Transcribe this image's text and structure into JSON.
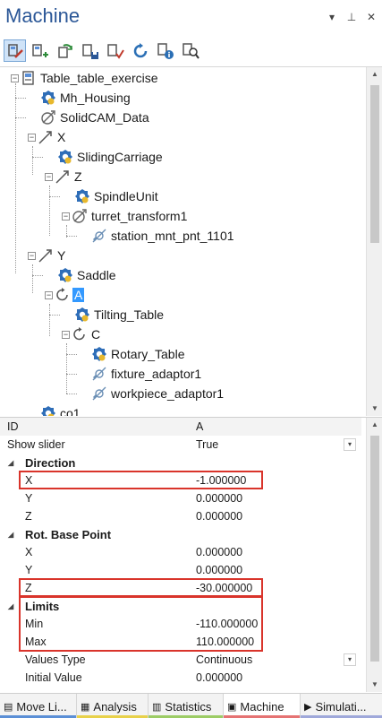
{
  "panel": {
    "title": "Machine",
    "controls": {
      "menu": "▾",
      "pin": "⊥",
      "close": "✕"
    }
  },
  "toolbar": {
    "buttons": [
      {
        "name": "edit-machine-icon"
      },
      {
        "name": "add-item-icon"
      },
      {
        "name": "refresh-icon"
      },
      {
        "name": "save-icon"
      },
      {
        "name": "check-icon"
      },
      {
        "name": "rotate-icon"
      },
      {
        "name": "info-icon"
      },
      {
        "name": "search-icon"
      }
    ]
  },
  "tree": {
    "nodes": [
      {
        "label": "Table_table_exercise",
        "icon": "machine"
      },
      {
        "label": "Mh_Housing",
        "icon": "part"
      },
      {
        "label": "SolidCAM_Data",
        "icon": "transform"
      },
      {
        "label": "X",
        "icon": "axis-linear"
      },
      {
        "label": "SlidingCarriage",
        "icon": "part"
      },
      {
        "label": "Z",
        "icon": "axis-linear"
      },
      {
        "label": "SpindleUnit",
        "icon": "part"
      },
      {
        "label": "turret_transform1",
        "icon": "transform"
      },
      {
        "label": "station_mnt_pnt_1101",
        "icon": "mount"
      },
      {
        "label": "Y",
        "icon": "axis-linear"
      },
      {
        "label": "Saddle",
        "icon": "part"
      },
      {
        "label": "A",
        "icon": "axis-rotary",
        "selected": true
      },
      {
        "label": "Tilting_Table",
        "icon": "part"
      },
      {
        "label": "C",
        "icon": "axis-rotary"
      },
      {
        "label": "Rotary_Table",
        "icon": "part"
      },
      {
        "label": "fixture_adaptor1",
        "icon": "mount"
      },
      {
        "label": "workpiece_adaptor1",
        "icon": "mount"
      },
      {
        "label": "co1",
        "icon": "part"
      }
    ]
  },
  "properties": {
    "id": {
      "name": "ID",
      "value": "A"
    },
    "show_slider": {
      "name": "Show slider",
      "value": "True"
    },
    "direction": {
      "title": "Direction",
      "x": {
        "name": "X",
        "value": "-1.000000"
      },
      "y": {
        "name": "Y",
        "value": "0.000000"
      },
      "z": {
        "name": "Z",
        "value": "0.000000"
      }
    },
    "rot_base_point": {
      "title": "Rot. Base Point",
      "x": {
        "name": "X",
        "value": "0.000000"
      },
      "y": {
        "name": "Y",
        "value": "0.000000"
      },
      "z": {
        "name": "Z",
        "value": "-30.000000"
      }
    },
    "limits": {
      "title": "Limits",
      "min": {
        "name": "Min",
        "value": "-110.000000"
      },
      "max": {
        "name": "Max",
        "value": "110.000000"
      }
    },
    "values_type": {
      "name": "Values Type",
      "value": "Continuous"
    },
    "initial_value": {
      "name": "Initial Value",
      "value": "0.000000"
    }
  },
  "tabs": [
    {
      "label": "Move Li...",
      "color": "#5b8fd6"
    },
    {
      "label": "Analysis",
      "color": "#e8d14a"
    },
    {
      "label": "Statistics",
      "color": "#9ccc65"
    },
    {
      "label": "Machine",
      "color": "#e57373"
    },
    {
      "label": "Simulati...",
      "color": "#9fa8da"
    }
  ],
  "colors": {
    "title": "#2b5797",
    "selection": "#3399ff",
    "highlight_box": "#d9342b"
  }
}
